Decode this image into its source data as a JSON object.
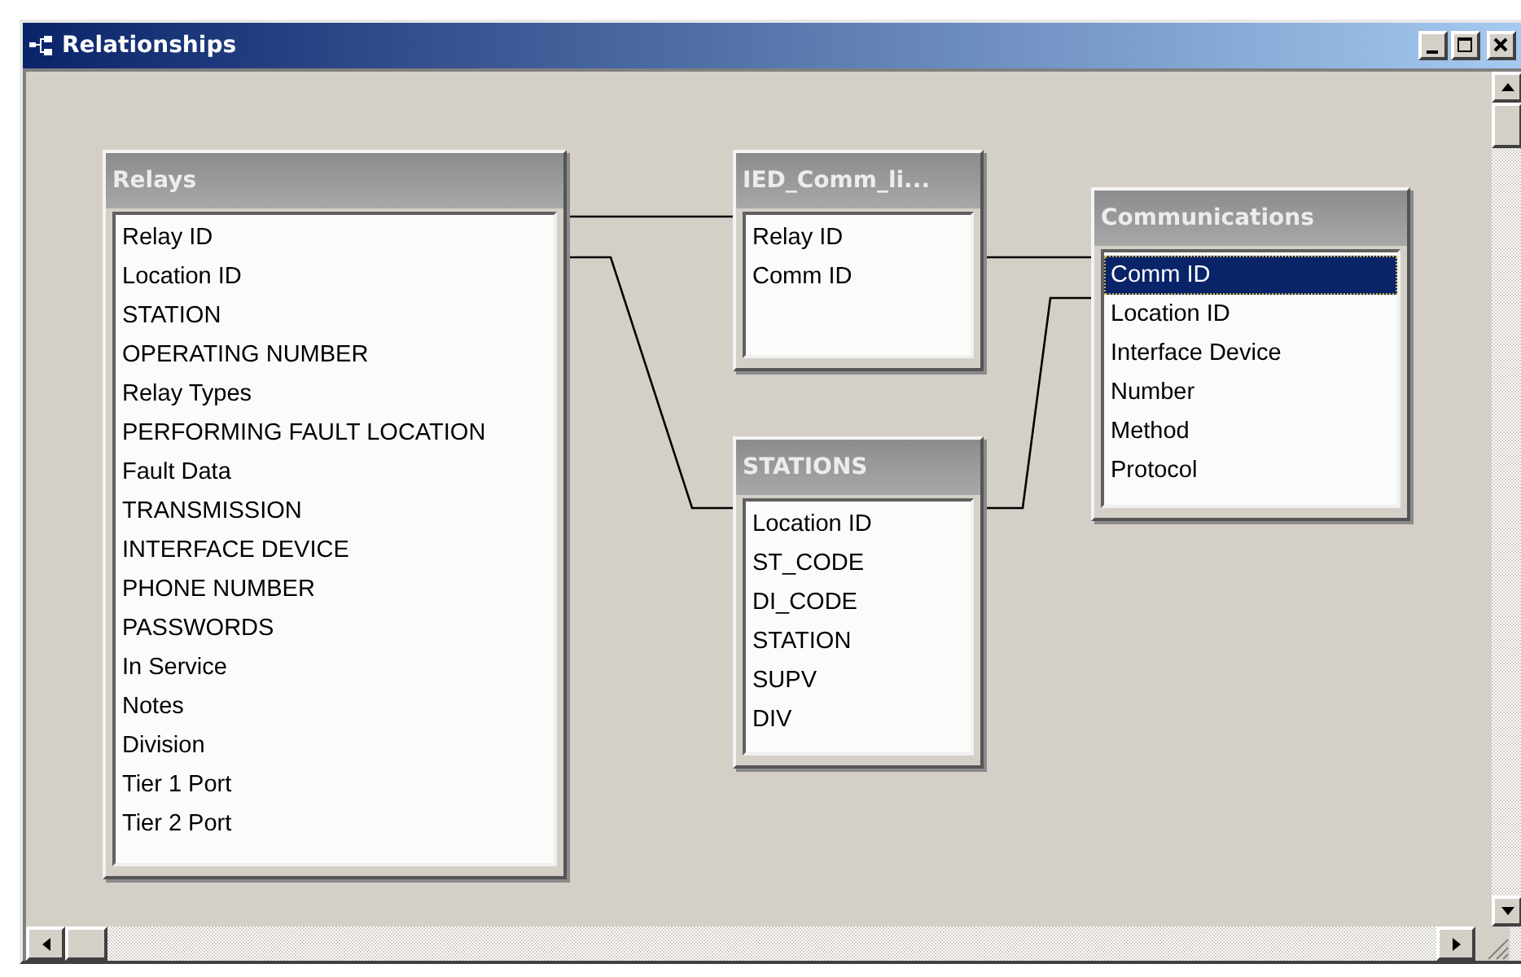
{
  "window": {
    "title": "Relationships"
  },
  "tables": [
    {
      "name": "Relays",
      "fields": [
        {
          "name": "Relay ID",
          "selected": false
        },
        {
          "name": "Location ID",
          "selected": false
        },
        {
          "name": "STATION",
          "selected": false
        },
        {
          "name": "OPERATING NUMBER",
          "selected": false
        },
        {
          "name": "Relay Types",
          "selected": false
        },
        {
          "name": "PERFORMING FAULT LOCATION",
          "selected": false
        },
        {
          "name": "Fault Data",
          "selected": false
        },
        {
          "name": "TRANSMISSION",
          "selected": false
        },
        {
          "name": "INTERFACE DEVICE",
          "selected": false
        },
        {
          "name": "PHONE NUMBER",
          "selected": false
        },
        {
          "name": "PASSWORDS",
          "selected": false
        },
        {
          "name": "In Service",
          "selected": false
        },
        {
          "name": "Notes",
          "selected": false
        },
        {
          "name": "Division",
          "selected": false
        },
        {
          "name": "Tier 1 Port",
          "selected": false
        },
        {
          "name": "Tier 2 Port",
          "selected": false
        }
      ]
    },
    {
      "name": "IED_Comm_li...",
      "fields": [
        {
          "name": "Relay ID",
          "selected": false
        },
        {
          "name": "Comm ID",
          "selected": false
        }
      ]
    },
    {
      "name": "Communications",
      "fields": [
        {
          "name": "Comm ID",
          "selected": true
        },
        {
          "name": "Location ID",
          "selected": false
        },
        {
          "name": "Interface Device",
          "selected": false
        },
        {
          "name": "Number",
          "selected": false
        },
        {
          "name": "Method",
          "selected": false
        },
        {
          "name": "Protocol",
          "selected": false
        }
      ]
    },
    {
      "name": "STATIONS",
      "fields": [
        {
          "name": "Location ID",
          "selected": false
        },
        {
          "name": "ST_CODE",
          "selected": false
        },
        {
          "name": "DI_CODE",
          "selected": false
        },
        {
          "name": "STATION",
          "selected": false
        },
        {
          "name": "SUPV",
          "selected": false
        },
        {
          "name": "DIV",
          "selected": false
        }
      ]
    }
  ]
}
